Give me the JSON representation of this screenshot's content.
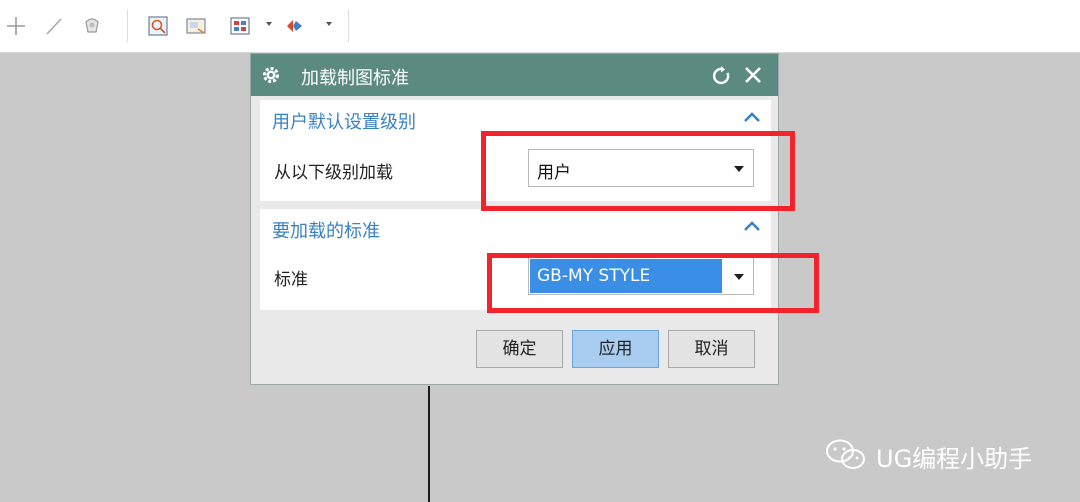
{
  "toolbar": {
    "icons": [
      "plus-icon",
      "line-icon",
      "shape-icon",
      "view-icon",
      "image-icon",
      "grid-icon",
      "arrow-dropdown-icon",
      "symbol-icon",
      "arrow-dropdown-icon"
    ]
  },
  "dialog": {
    "title": "加载制图标准",
    "groups": [
      {
        "title": "用户默认设置级别",
        "row_label": "从以下级别加载",
        "select_value": "用户"
      },
      {
        "title": "要加载的标准",
        "row_label": "标准",
        "select_value": "GB-MY STYLE"
      }
    ],
    "buttons": {
      "ok": "确定",
      "apply": "应用",
      "cancel": "取消"
    }
  },
  "watermark": {
    "text": "UG编程小助手"
  },
  "colors": {
    "title_bar": "#5b8a80",
    "group_title": "#3a82c6",
    "highlight_box": "#f2232b",
    "selection": "#3a8ee6",
    "primary_button": "#a9cdf0"
  }
}
